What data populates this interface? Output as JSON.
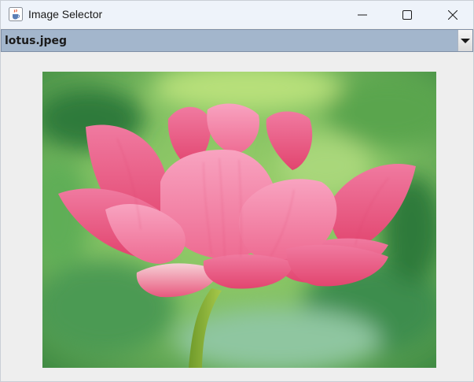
{
  "window": {
    "title": "Image Selector",
    "icon": "java-cup-icon"
  },
  "controls": {
    "minimize": "minimize-icon",
    "maximize": "maximize-icon",
    "close": "close-icon"
  },
  "combo": {
    "selected": "lotus.jpeg",
    "arrow_icon": "chevron-down-icon"
  },
  "image": {
    "subject": "lotus-flower"
  },
  "colors": {
    "titlebar": "#eef3fa",
    "combo_bg": "#a3b6cc",
    "window_bg": "#eeeeee",
    "petal_pink": "#f0628a"
  }
}
